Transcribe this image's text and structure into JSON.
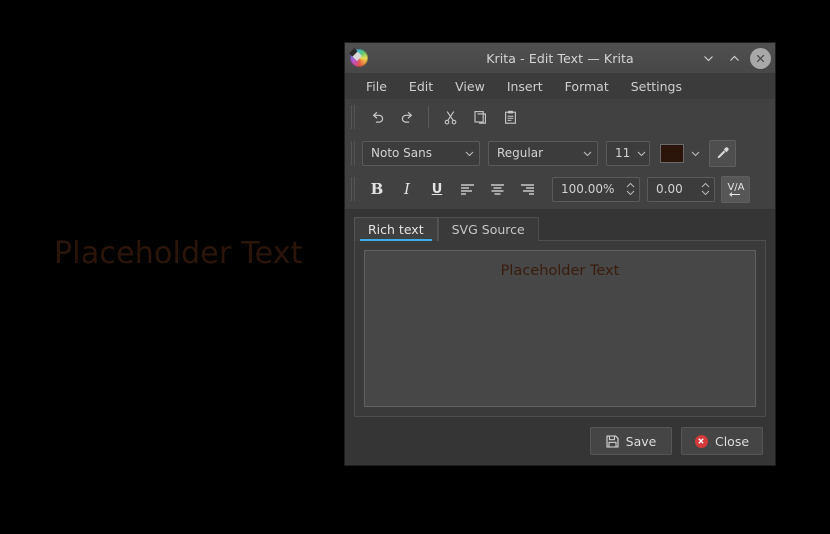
{
  "canvas": {
    "text": "Placeholder Text",
    "text_color": "#2b1409",
    "background": "#000000"
  },
  "window": {
    "title": "Krita - Edit Text — Krita",
    "logo_icon": "krita-logo-icon",
    "controls": [
      {
        "name": "minimize-button",
        "icon": "chevron-down-icon"
      },
      {
        "name": "maximize-button",
        "icon": "chevron-up-icon"
      },
      {
        "name": "close-window-button",
        "icon": "close-x-icon"
      }
    ]
  },
  "menubar": {
    "items": [
      {
        "label": "File"
      },
      {
        "label": "Edit"
      },
      {
        "label": "View"
      },
      {
        "label": "Insert"
      },
      {
        "label": "Format"
      },
      {
        "label": "Settings"
      }
    ]
  },
  "edit_toolbar": {
    "buttons": [
      {
        "name": "undo-button",
        "icon": "undo-icon",
        "label": "Undo"
      },
      {
        "name": "redo-button",
        "icon": "redo-icon",
        "label": "Redo"
      },
      {
        "name": "cut-button",
        "icon": "scissors-icon",
        "label": "Cut"
      },
      {
        "name": "copy-button",
        "icon": "copy-icon",
        "label": "Copy"
      },
      {
        "name": "paste-button",
        "icon": "clipboard-icon",
        "label": "Paste"
      }
    ]
  },
  "font_toolbar": {
    "font_family": "Noto Sans",
    "font_style": "Regular",
    "font_size": "11",
    "text_color": "#2b1409",
    "eyedropper_icon": "eyedropper-icon",
    "dropdown_icon": "chevron-down-icon"
  },
  "format_toolbar": {
    "bold_label": "B",
    "italic_label": "I",
    "underline_label": "U",
    "align_left_icon": "align-left-icon",
    "align_center_icon": "align-center-icon",
    "align_right_icon": "align-right-icon",
    "line_height": "100.00%",
    "letter_spacing": "0.00",
    "kerning_label": "V/A"
  },
  "tabs": [
    {
      "label": "Rich text",
      "active": true
    },
    {
      "label": "SVG Source",
      "active": false
    }
  ],
  "editor": {
    "content": "Placeholder Text",
    "text_color": "#3a1c0e"
  },
  "footer": {
    "save_label": "Save",
    "save_icon": "floppy-disk-icon",
    "close_label": "Close",
    "close_icon": "close-circle-icon"
  },
  "theme": {
    "accent": "#3daee9",
    "dialog_bg": "#353535",
    "titlebar_bg": "#4a4a4a",
    "close_red": "#d33a3a"
  }
}
